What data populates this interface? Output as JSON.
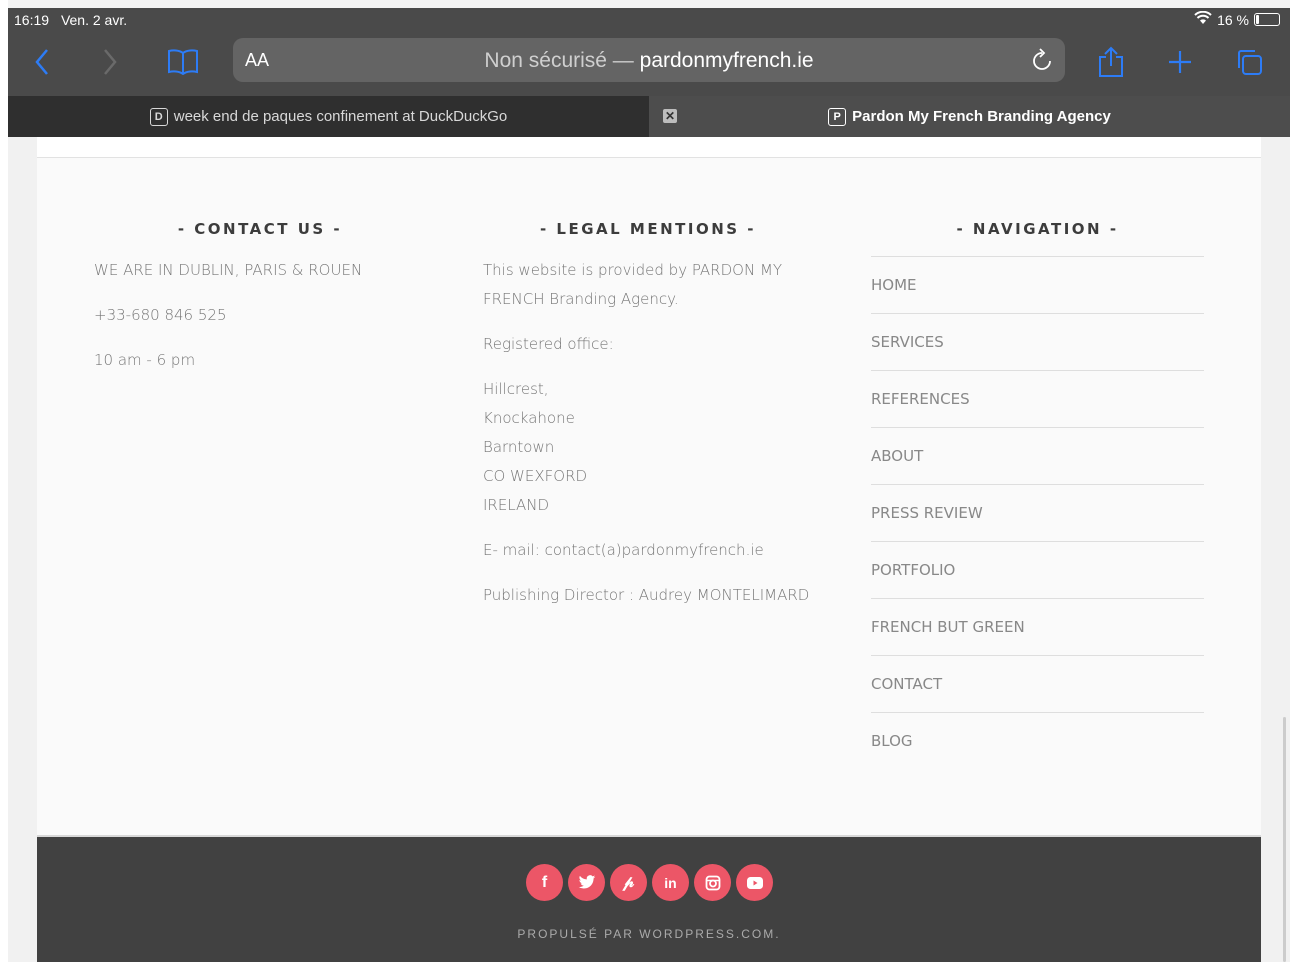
{
  "status_bar": {
    "time": "16:19",
    "date": "Ven. 2 avr.",
    "battery": "16 %"
  },
  "toolbar": {
    "text_size_label": "AA",
    "url_insecure": "Non sécurisé —",
    "url_domain": "pardonmyfrench.ie"
  },
  "tabs": [
    {
      "favicon": "D",
      "title": "week end de paques confinement at DuckDuckGo"
    },
    {
      "favicon": "P",
      "title": "Pardon My French Branding Agency"
    }
  ],
  "contact": {
    "heading": "- CONTACT US -",
    "lines": [
      "WE ARE IN DUBLIN, PARIS & ROUEN",
      "+33-680 846 525",
      "10 am - 6 pm"
    ]
  },
  "legal": {
    "heading": "- LEGAL MENTIONS -",
    "line1": "This website is provided by PARDON MY",
    "line2": "FRENCH Branding Agency.",
    "office_label": "Registered office:",
    "address": [
      "Hillcrest,",
      "Knockahone",
      "Barntown",
      "CO WEXFORD",
      "IRELAND"
    ],
    "email": "E- mail: contact(a)pardonmyfrench.ie",
    "director": "Publishing Director : Audrey MONTELIMARD"
  },
  "navigation": {
    "heading": "- NAVIGATION -",
    "items": [
      "HOME",
      "SERVICES",
      "REFERENCES",
      "ABOUT",
      "PRESS REVIEW",
      "PORTFOLIO",
      "FRENCH BUT GREEN",
      "CONTACT",
      "BLOG"
    ]
  },
  "social_icons": [
    "facebook-icon",
    "twitter-icon",
    "pinterest-icon",
    "linkedin-icon",
    "instagram-icon",
    "youtube-icon"
  ],
  "footer_credit": "PROPULSÉ PAR WORDPRESS.COM.",
  "colors": {
    "accent": "#ec5667",
    "browser_chrome": "#4a4a4a",
    "footer_dark": "#414141",
    "ios_blue": "#2d7cf6"
  }
}
